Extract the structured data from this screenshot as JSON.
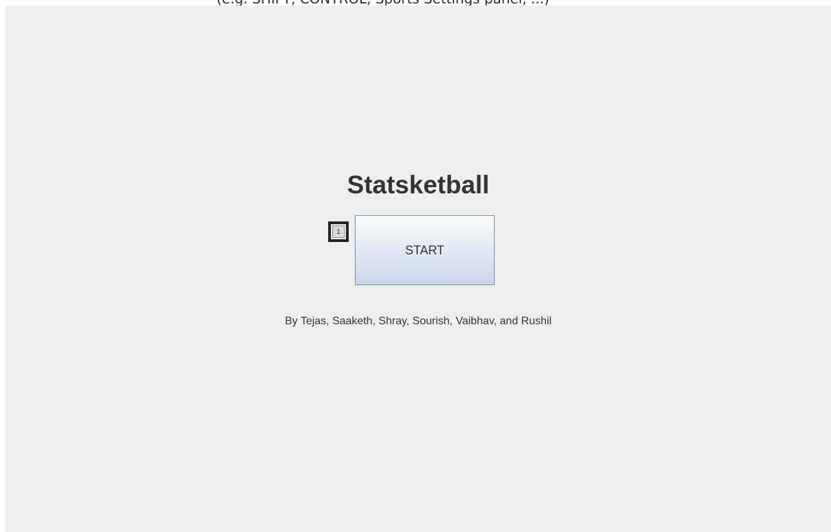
{
  "top_strip": {
    "text": "(e.g. SHIFT, CONTROL, Sports Settings panel, ...)"
  },
  "app": {
    "title": "Statsketball",
    "start_button_label": "START",
    "marker_label": "1",
    "credits": "By Tejas, Saaketh, Shray, Sourish, Vaibhav, and Rushil"
  },
  "colors": {
    "panel_background": "#eeeeee",
    "text": "#333333",
    "button_border": "#7a8ba8",
    "button_gradient_top": "#fbfcfd",
    "button_gradient_bottom": "#c9d7ea"
  }
}
